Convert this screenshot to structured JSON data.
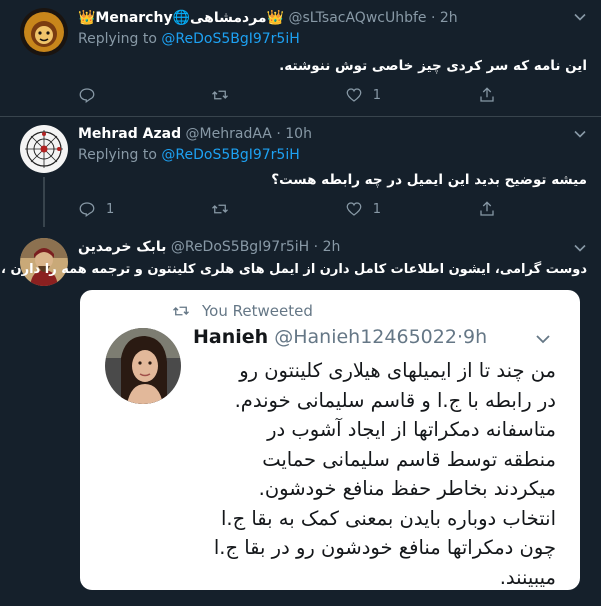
{
  "tweets": [
    {
      "name": "👑Menarchy🌐مردمشاهی👑",
      "handle": "@sLTsacAQwcUhbfe",
      "time": "2h",
      "replying_label": "Replying to",
      "replying_to": "@ReDoS5BgI97r5iH",
      "text": "این نامه که سر کردی چیز خاصی توش ننوشته.",
      "reply_count": "",
      "retweet_count": "",
      "like_count": "1"
    },
    {
      "name": "Mehrad Azad",
      "handle": "@MehradAA",
      "time": "10h",
      "replying_label": "Replying to",
      "replying_to": "@ReDoS5BgI97r5iH",
      "text": "میشه توضیح بدید این ایمیل در چه رابطه هست؟",
      "reply_count": "1",
      "retweet_count": "",
      "like_count": "1"
    },
    {
      "name": "بابک خرمدین",
      "handle": "@ReDoS5BgI97r5iH",
      "time": "2h",
      "text": "دوست گرامی، ایشون اطلاعات کامل دارن از ایمل های هلری کلینتون و ترجمه همه را دارن ،"
    }
  ],
  "separator": "·",
  "quoted": {
    "retweet_label": "You Retweeted",
    "name": "Hanieh",
    "handle": "@Hanieh12465022",
    "time": "9h",
    "lines": [
      "من چند تا از ایمیلهای هیلاری کلینتون رو",
      "در رابطه با ج.ا و قاسم سلیمانی خوندم.",
      "متاسفانه دمکراتها از ایجاد آشوب در",
      "منطقه توسط قاسم سلیمانی حمایت",
      "میکردند بخاطر حفظ منافع خودشون.",
      "انتخاب دوباره بایدن بمعنی کمک به بقا ج.ا",
      "چون دمکراتها منافع خودشون رو در بقا ج.ا",
      "میبینند."
    ]
  },
  "colors": {
    "background": "#15202b",
    "divider": "#38444d",
    "secondary_text": "#8899a6",
    "link": "#1da1f2"
  }
}
